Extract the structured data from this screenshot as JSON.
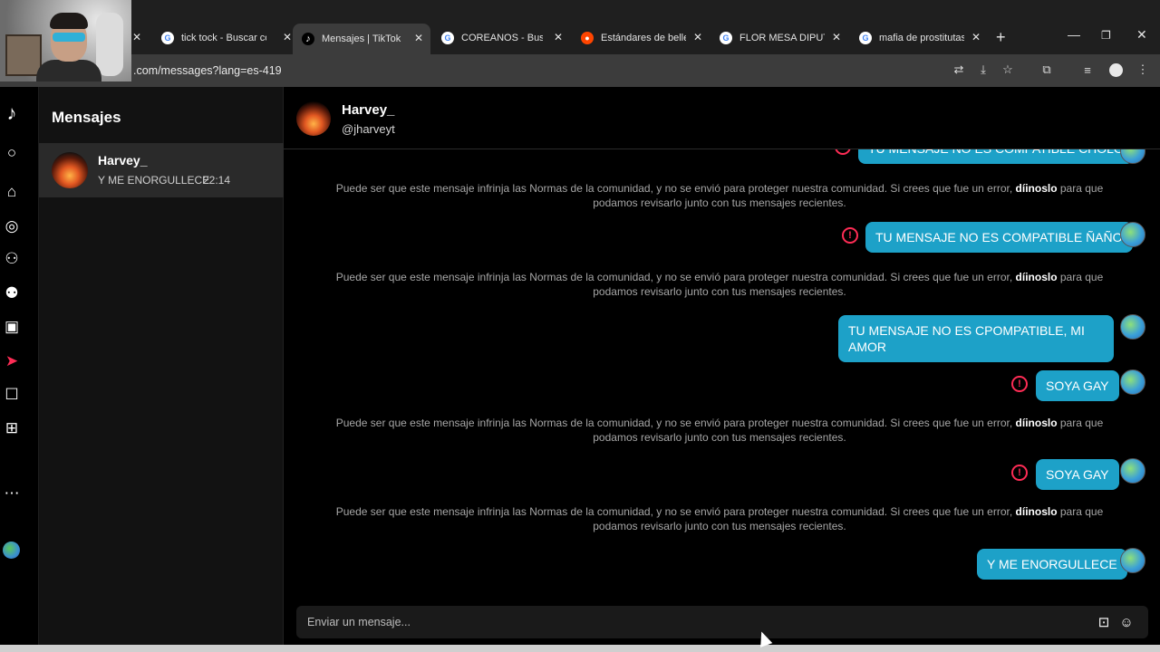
{
  "browser": {
    "tabs": [
      {
        "title": "tick tock - Buscar con Google",
        "favicon": "google-icon"
      },
      {
        "title": "Mensajes | TikTok",
        "favicon": "tiktok-icon",
        "active": true
      },
      {
        "title": "COREANOS - Buscar con Google",
        "favicon": "google-icon"
      },
      {
        "title": "Estándares de belleza",
        "favicon": "reddit-icon"
      },
      {
        "title": "FLOR MESA DIPUTADA",
        "favicon": "google-icon"
      },
      {
        "title": "mafia de prostitutas",
        "favicon": "google-icon"
      }
    ],
    "url": ".com/messages?lang=es-419",
    "icons": [
      "translate-icon",
      "install-icon",
      "star-icon",
      "extensions-icon",
      "media-icon",
      "profile-icon",
      "menu-icon"
    ]
  },
  "nav": {
    "icons": [
      "tiktok-logo-icon",
      "search-icon",
      "home-icon",
      "explore-icon",
      "following-icon",
      "friends-icon",
      "live-icon",
      "messages-icon",
      "inbox-icon",
      "upload-icon",
      "profile-avatar",
      "more-icon"
    ]
  },
  "inbox": {
    "title": "Mensajes",
    "conversations": [
      {
        "name": "Harvey_",
        "preview": "Y ME ENORGULLECE",
        "time": "22:14"
      }
    ]
  },
  "chat": {
    "contact_name": "Harvey_",
    "contact_handle": "@jharveyt",
    "notice": {
      "text_before": "Puede ser que este mensaje infrinja las Normas de la comunidad, y no se envió para proteger nuestra comunidad. Si crees que fue un error,",
      "link": "díinoslo",
      "text_after": "para que podamos revisarlo junto con tus mensajes recientes."
    },
    "messages": [
      {
        "text": "TU MENSAJE NO ES COMPATIBLE CHOLO",
        "blocked": true
      },
      {
        "text": "TU MENSAJE NO ES COMPATIBLE ÑAÑO",
        "blocked": true
      },
      {
        "text": "TU MENSAJE NO ES CPOMPATIBLE, MI AMOR",
        "blocked": false
      },
      {
        "text": "SOYA GAY",
        "blocked": true
      },
      {
        "text": "SOYA GAY",
        "blocked": true
      },
      {
        "text": "Y ME ENORGULLECE",
        "blocked": false
      }
    ],
    "input_placeholder": "Enviar un mensaje..."
  },
  "colors": {
    "bubble": "#1da1c8",
    "warning": "#fe2c55",
    "background": "#000000"
  }
}
